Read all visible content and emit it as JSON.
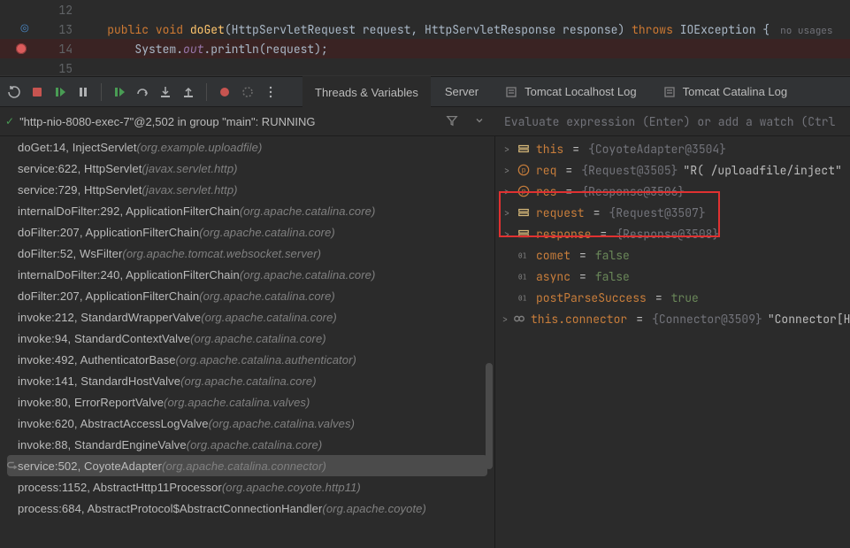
{
  "editor": {
    "lines": [
      {
        "num": "12",
        "bp": false,
        "glyph": "",
        "tokens": []
      },
      {
        "num": "13",
        "bp": false,
        "glyph": "target",
        "tokens": [
          {
            "t": "    ",
            "c": ""
          },
          {
            "t": "public",
            "c": "kw"
          },
          {
            "t": " ",
            "c": ""
          },
          {
            "t": "void",
            "c": "kw"
          },
          {
            "t": " ",
            "c": ""
          },
          {
            "t": "doGet",
            "c": "fn"
          },
          {
            "t": "(HttpServletRequest request, HttpServletResponse response) ",
            "c": "id"
          },
          {
            "t": "throws",
            "c": "kw"
          },
          {
            "t": " ",
            "c": ""
          },
          {
            "t": "IOException {",
            "c": "id"
          }
        ],
        "usages": "no usages"
      },
      {
        "num": "14",
        "bp": true,
        "glyph": "",
        "tokens": [
          {
            "t": "        System.",
            "c": "id"
          },
          {
            "t": "out",
            "c": "field"
          },
          {
            "t": ".println(request);",
            "c": "id"
          }
        ]
      },
      {
        "num": "15",
        "bp": false,
        "glyph": "",
        "tokens": []
      }
    ]
  },
  "tabs": {
    "threads": "Threads & Variables",
    "server": "Server",
    "localhost": "Tomcat Localhost Log",
    "catalina": "Tomcat Catalina Log"
  },
  "thread": {
    "label": "\"http-nio-8080-exec-7\"@2,502 in group \"main\": RUNNING",
    "eval_placeholder": "Evaluate expression (Enter) or add a watch (Ctrl"
  },
  "frames": [
    {
      "m": "doGet:14, InjectServlet ",
      "p": "(org.example.uploadfile)"
    },
    {
      "m": "service:622, HttpServlet ",
      "p": "(javax.servlet.http)"
    },
    {
      "m": "service:729, HttpServlet ",
      "p": "(javax.servlet.http)"
    },
    {
      "m": "internalDoFilter:292, ApplicationFilterChain ",
      "p": "(org.apache.catalina.core)"
    },
    {
      "m": "doFilter:207, ApplicationFilterChain ",
      "p": "(org.apache.catalina.core)"
    },
    {
      "m": "doFilter:52, WsFilter ",
      "p": "(org.apache.tomcat.websocket.server)"
    },
    {
      "m": "internalDoFilter:240, ApplicationFilterChain ",
      "p": "(org.apache.catalina.core)"
    },
    {
      "m": "doFilter:207, ApplicationFilterChain ",
      "p": "(org.apache.catalina.core)"
    },
    {
      "m": "invoke:212, StandardWrapperValve ",
      "p": "(org.apache.catalina.core)"
    },
    {
      "m": "invoke:94, StandardContextValve ",
      "p": "(org.apache.catalina.core)"
    },
    {
      "m": "invoke:492, AuthenticatorBase ",
      "p": "(org.apache.catalina.authenticator)"
    },
    {
      "m": "invoke:141, StandardHostValve ",
      "p": "(org.apache.catalina.core)"
    },
    {
      "m": "invoke:80, ErrorReportValve ",
      "p": "(org.apache.catalina.valves)"
    },
    {
      "m": "invoke:620, AbstractAccessLogValve ",
      "p": "(org.apache.catalina.valves)"
    },
    {
      "m": "invoke:88, StandardEngineValve ",
      "p": "(org.apache.catalina.core)"
    },
    {
      "m": "service:502, CoyoteAdapter ",
      "p": "(org.apache.catalina.connector)",
      "sel": true,
      "ret": true
    },
    {
      "m": "process:1152, AbstractHttp11Processor ",
      "p": "(org.apache.coyote.http11)"
    },
    {
      "m": "process:684, AbstractProtocol$AbstractConnectionHandler ",
      "p": "(org.apache.coyote)"
    }
  ],
  "vars": [
    {
      "chev": ">",
      "icon": "obj",
      "name": "this",
      "eq": " = ",
      "val": "{CoyoteAdapter@3504}"
    },
    {
      "chev": ">",
      "icon": "param",
      "name": "req",
      "eq": " = ",
      "val": "{Request@3505}",
      "str": " \"R( /uploadfile/inject\""
    },
    {
      "chev": ">",
      "icon": "param",
      "name": "res",
      "eq": " = ",
      "val": "{Response@3506}"
    },
    {
      "chev": ">",
      "icon": "obj",
      "name": "request",
      "eq": " = ",
      "val": "{Request@3507}",
      "hl": true
    },
    {
      "chev": ">",
      "icon": "obj",
      "name": "response",
      "eq": " = ",
      "val": "{Response@3508}",
      "hl": true
    },
    {
      "chev": "",
      "icon": "bool",
      "name": "comet",
      "eq": " = ",
      "lit": "false"
    },
    {
      "chev": "",
      "icon": "bool",
      "name": "async",
      "eq": " = ",
      "lit": "false"
    },
    {
      "chev": "",
      "icon": "bool",
      "name": "postParseSuccess",
      "eq": " = ",
      "lit": "true"
    },
    {
      "chev": ">",
      "icon": "link",
      "name": "this.connector",
      "eq": " = ",
      "val": "{Connector@3509}",
      "str": " \"Connector[HTTP"
    }
  ]
}
